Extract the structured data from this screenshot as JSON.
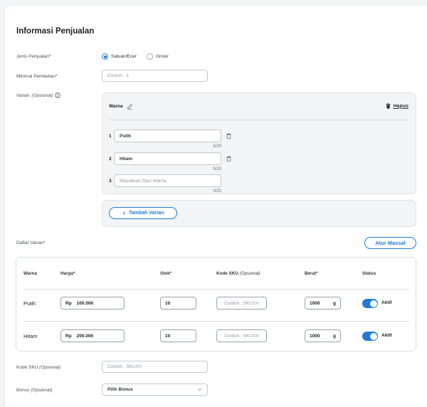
{
  "section_title": "Informasi Penjualan",
  "jenis": {
    "label": "Jenis Penjualan*",
    "options": [
      {
        "label": "Satuan/Ecer",
        "selected": true
      },
      {
        "label": "Grosir",
        "selected": false
      }
    ]
  },
  "minimal": {
    "label": "Minimal Pembelian*",
    "placeholder": "Contoh : 1"
  },
  "varian": {
    "label": "Varian",
    "label_optional": "(Opsional)",
    "info_icon": "info-icon",
    "group_name": "Warna",
    "edit_icon": "pencil-icon",
    "delete_label": "Hapus",
    "options": [
      {
        "num": "1",
        "value": "Putih",
        "counter": "5/20"
      },
      {
        "num": "2",
        "value": "Hitam",
        "counter": "5/20"
      },
      {
        "num": "3",
        "placeholder": "Masukkan Opsi Warna",
        "counter": "0/20"
      }
    ],
    "add_button": "Tambah Varian"
  },
  "daftar": {
    "label": "Daftar Varian*",
    "bulk_button": "Atur Massal",
    "headers": {
      "warna": "Warna",
      "harga": "Harga*",
      "stok": "Stok*",
      "sku": "Kode SKU",
      "sku_optional": "(Opsional)",
      "berat": "Berat*",
      "status": "Status"
    },
    "rows": [
      {
        "name": "Putih",
        "price_prefix": "Rp",
        "price": "100.000",
        "stock": "10",
        "sku_placeholder": "Contoh : SKUXX",
        "weight": "1000",
        "weight_unit": "g",
        "status": "Aktif",
        "active": true
      },
      {
        "name": "Hitam",
        "price_prefix": "Rp",
        "price": "200.000",
        "stock": "10",
        "sku_placeholder": "Contoh : SKUXX",
        "weight": "1000",
        "weight_unit": "g",
        "status": "Aktif",
        "active": true
      }
    ]
  },
  "kode_sku": {
    "label": "Kode SKU",
    "label_optional": "(Opsional)",
    "placeholder": "Contoh : SKUXX"
  },
  "bonus": {
    "label": "Bonus",
    "label_optional": "(Opsional)",
    "value": "Pilih Bonus"
  },
  "colors": {
    "accent": "#1f7bd6",
    "panel": "#f3f4f5",
    "border": "#c4c8ce"
  }
}
